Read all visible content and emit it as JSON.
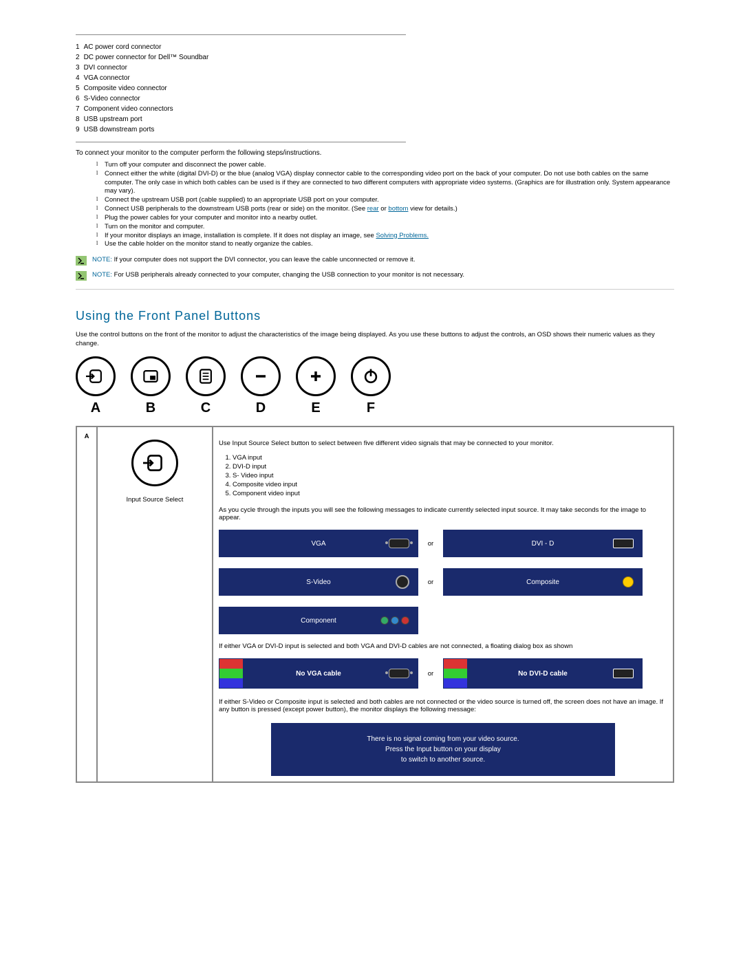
{
  "connectors": [
    {
      "num": "1",
      "label": "AC power cord connector"
    },
    {
      "num": "2",
      "label": "DC power connector for Dell™ Soundbar"
    },
    {
      "num": "3",
      "label": "DVI connector"
    },
    {
      "num": "4",
      "label": "VGA connector"
    },
    {
      "num": "5",
      "label": "Composite video connector"
    },
    {
      "num": "6",
      "label": "S-Video connector"
    },
    {
      "num": "7",
      "label": "Component video connectors"
    },
    {
      "num": "8",
      "label": "USB upstream port"
    },
    {
      "num": "9",
      "label": "USB downstream ports"
    }
  ],
  "instruction_intro": "To connect your monitor to the computer perform the following steps/instructions.",
  "steps": {
    "s1": "Turn off your computer and disconnect the power cable.",
    "s2": "Connect either the white (digital DVI-D) or the blue (analog VGA) display connector cable to the corresponding video port on the back of your computer. Do not use both cables on the same computer. The only case in which both cables can be used is if they are connected to two different computers with appropriate video systems. (Graphics are for illustration only. System appearance may vary).",
    "s3": "Connect the upstream USB port (cable supplied) to an appropriate USB port on your computer.",
    "s4_pre": "Connect USB peripherals to the downstream USB ports (rear or side) on the monitor. (See ",
    "s4_link1": "rear",
    "s4_mid": " or ",
    "s4_link2": "bottom",
    "s4_post": " view for details.)",
    "s5": "Plug the power cables for your computer and monitor into a nearby outlet.",
    "s6": "Turn on the monitor and computer.",
    "s6b_pre": "If your monitor displays an image, installation is complete. If it does not display an image, see ",
    "s6b_link": "Solving Problems.",
    "s7": "Use the cable holder on the monitor stand to neatly organize the cables."
  },
  "note1_label": "NOTE:",
  "note1": " If your computer does not support the DVI connector, you can leave the cable unconnected or remove it.",
  "note2_label": "NOTE:",
  "note2": " For USB peripherals already connected to your computer, changing the USB connection to your monitor is not necessary.",
  "section_title": "Using the Front Panel Buttons",
  "section_desc": "Use the control buttons on the front of the monitor to adjust the characteristics of the image being displayed. As you use these buttons to adjust the controls, an OSD shows their numeric values as they change.",
  "letters": {
    "a": "A",
    "b": "B",
    "c": "C",
    "d": "D",
    "e": "E",
    "f": "F"
  },
  "table": {
    "key": "A",
    "icon_label": "Input Source Select",
    "intro": "Use Input Source Select button to select between five different video signals that may be connected to your monitor.",
    "inputs": [
      "VGA input",
      "DVI-D input",
      "S- Video input",
      "Composite video input",
      "Component video input"
    ],
    "cycle_text": "As you cycle through the inputs you will see the following messages to indicate currently selected input source. It may take seconds for the image to appear.",
    "sources": {
      "vga": "VGA",
      "dvid": "DVI - D",
      "svideo": "S-Video",
      "composite": "Composite",
      "component": "Component",
      "or": "or"
    },
    "no_cable_text": "If either VGA or DVI-D input is selected and both VGA and DVI-D cables are not connected, a floating dialog box as shown",
    "no_vga": "No VGA cable",
    "no_dvi": "No DVI-D cable",
    "svideo_off_text": "If either S-Video or Composite input is selected and both cables are not connected or the video source is turned off, the screen does not have an image. If any button is pressed (except power button), the monitor displays the following message:",
    "nosignal_l1": "There is no signal coming from your video source.",
    "nosignal_l2": "Press the Input button on your display",
    "nosignal_l3": "to switch to another source."
  }
}
